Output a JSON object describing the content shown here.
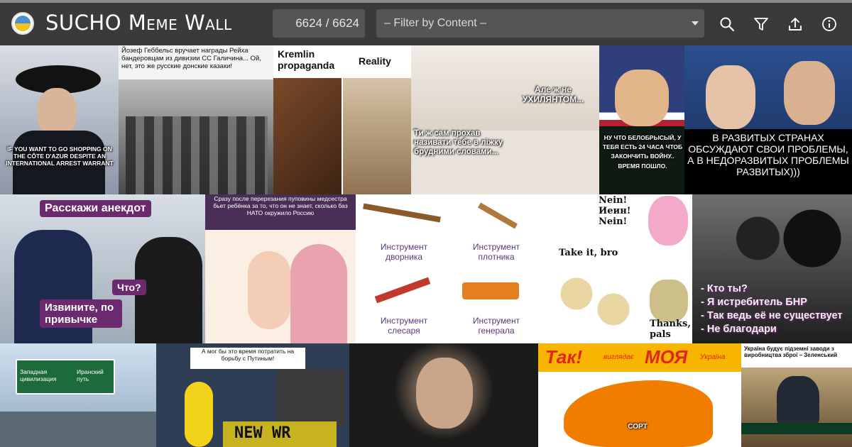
{
  "app": {
    "title": "SUCHO Meme Wall",
    "counter": "6624 / 6624",
    "filter_placeholder": "– Filter by Content –"
  },
  "toolbar": {
    "icons": [
      "search-icon",
      "filter-icon",
      "upload-icon",
      "info-icon"
    ]
  },
  "colors": {
    "topbar": "#3a3a3a",
    "field_bg": "#555555",
    "bubble": "#6b2a6e"
  },
  "tiles": {
    "t1": {
      "caption": "IF YOU WANT TO GO SHOPPING ON THE CÔTE D'AZUR DESPITE AN INTERNATIONAL ARREST WARRANT"
    },
    "t2": {
      "caption": "Йозеф Геббельс вручает награды Рейха бандеровцам из дивизии СС Галичина... Ой, нет, это же русские донские казаки!"
    },
    "t3": {
      "left": "Kremlin propaganda",
      "right": "Reality"
    },
    "t4": {
      "top": "Але ж не УХИЛЯНТОМ...",
      "bottom": "Ти ж сам прохав називати тебе в ліжку брудними словами..."
    },
    "t5": {
      "caption": "НУ ЧТО БЕЛОБРЫСЫЙ, У ТЕБЯ ЕСТЬ 24 ЧАСА ЧТОБ ЗАКОНЧИТЬ ВОЙНУ.. ВРЕМЯ ПОШЛО."
    },
    "t6": {
      "caption": "В РАЗВИТЫХ СТРАНАХ ОБСУЖДАЮТ СВОИ ПРОБЛЕМЫ, А В НЕДОРАЗВИТЫХ ПРОБЛЕМЫ РАЗВИТЫХ)))"
    },
    "t7": {
      "b1": "Расскажи анекдот",
      "b2": "Что?",
      "b3": "Извините, по привычке"
    },
    "t8": {
      "caption": "Сразу после перерезания пуповины медсестра бьет ребёнка за то, что он не знает, сколько баз НАТО окружило Россию"
    },
    "t9": {
      "a": "Инструмент дворника",
      "b": "Инструмент плотника",
      "c": "Инструмент слесаря",
      "d": "Инструмент генерала"
    },
    "t10": {
      "top": "Nein! Иeин! Nein!",
      "mid": "Take it, bro",
      "bottom": "Thanks, pals"
    },
    "t11": {
      "caption": "- Кто ты?\n- Я истребитель БНР\n- Так ведь её не существует\n- Не благодари"
    },
    "t12": {
      "left": "Западная цивилизация",
      "right": "Иранский путь"
    },
    "t13": {
      "caption": "А мог бы это время потратить на борьбу с Путиным!",
      "board": "NEW WR"
    },
    "t15": {
      "title_a": "Так!",
      "title_b": "виглядає",
      "title_c": "МОЯ",
      "title_d": "Україна",
      "map_label": "СОРТ"
    },
    "t16": {
      "caption": "Україна будує підземні заводи з виробництва зброї – Зеленський"
    }
  }
}
